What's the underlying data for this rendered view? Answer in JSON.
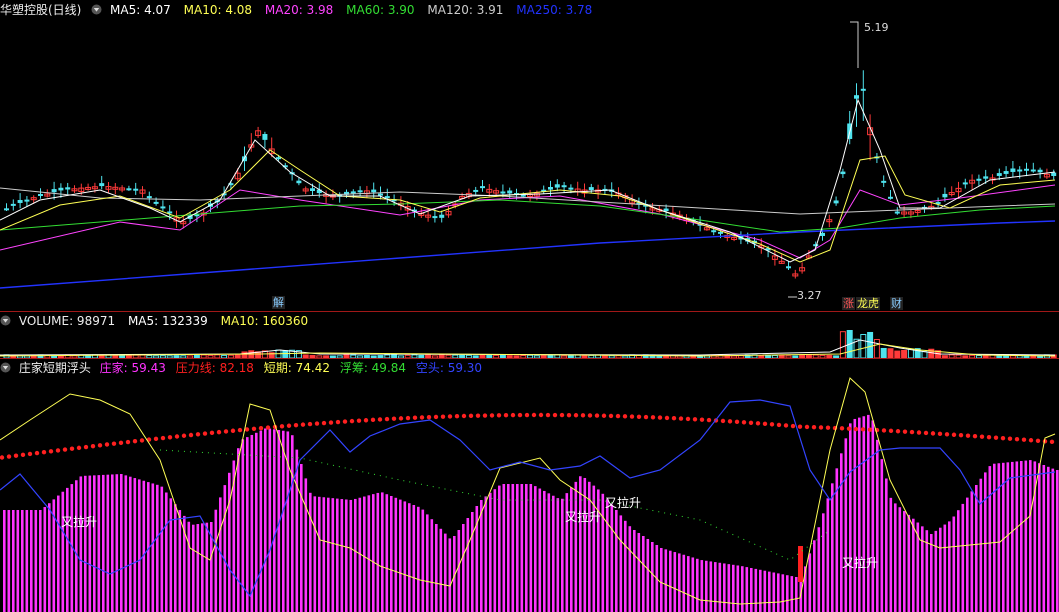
{
  "colors": {
    "up": "#ff3a3a",
    "down": "#4fe3ee",
    "ma5": "#ffffff",
    "ma10": "#ffff55",
    "ma20": "#ff44ff",
    "ma60": "#33dd33",
    "ma120": "#cccccc",
    "ma250": "#2233ff",
    "zhuangjia": "#ff33ff",
    "yali": "#ff2020",
    "duanqi": "#ffff55",
    "fuchou": "#33dd33",
    "kongtou": "#3344ff"
  },
  "price_header": {
    "title": "华塑控股(日线)",
    "ma5": "MA5: 4.07",
    "ma10": "MA10: 4.08",
    "ma20": "MA20: 3.98",
    "ma60": "MA60: 3.90",
    "ma120": "MA120: 3.91",
    "ma250": "MA250: 3.78"
  },
  "volume_header": {
    "volume": "VOLUME: 98971",
    "ma5": "MA5: 132339",
    "ma10": "MA10: 160360"
  },
  "indicator_header": {
    "title": "庄家短期浮头",
    "zhuangjia": "庄家: 59.43",
    "yali": "压力线: 82.18",
    "duanqi": "短期: 74.42",
    "fuchou": "浮筹: 49.84",
    "kongtou": "空头: 59.30"
  },
  "price_labels": {
    "high": "5.19",
    "low": "3.27"
  },
  "markers": {
    "zhang": "涨",
    "longhu": "龙虎",
    "cai": "财",
    "jie": "解"
  },
  "signals": [
    "又拉升",
    "又拉升",
    "又拉升",
    "又拉升"
  ]
}
